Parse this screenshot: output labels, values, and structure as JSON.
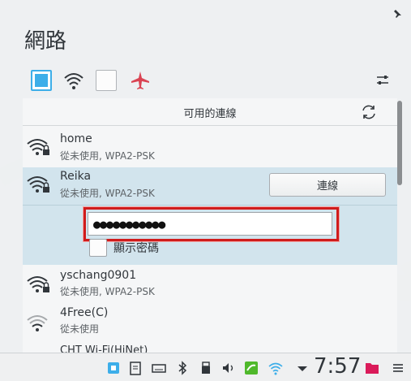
{
  "window": {
    "title": "網路"
  },
  "list": {
    "header": "可用的連線"
  },
  "networks": [
    {
      "ssid": "home",
      "status": "從未使用, WPA2-PSK"
    },
    {
      "ssid": "Reika",
      "status": "從未使用, WPA2-PSK"
    },
    {
      "ssid": "yschang0901",
      "status": "從未使用, WPA2-PSK"
    },
    {
      "ssid": "4Free(C)",
      "status": "從未使用"
    }
  ],
  "connect_panel": {
    "connect_label": "連線",
    "password_value": "●●●●●●●●●●●",
    "show_password_label": "顯示密碼"
  },
  "partial_next": "CHT Wi-Fi(HiNet)",
  "taskbar": {
    "clock": "7:57"
  },
  "colors": {
    "accent": "#3daee9",
    "highlight_border": "#d01c1c",
    "airplane": "#da4453"
  },
  "icons": [
    "pin-icon",
    "wired-checkbox",
    "wifi-icon",
    "mobile-checkbox",
    "airplane-icon",
    "settings-icon",
    "refresh-icon",
    "lock-icon"
  ]
}
